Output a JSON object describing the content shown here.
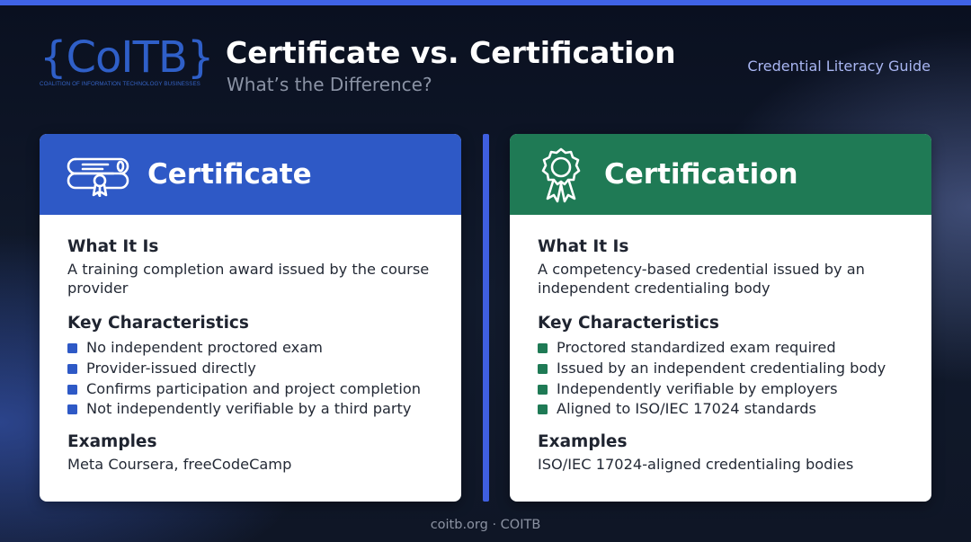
{
  "brand": {
    "logo_text": "{CoITB}",
    "logo_tagline": "COALITION OF INFORMATION TECHNOLOGY BUSINESSES"
  },
  "header": {
    "title": "Certificate vs. Certification",
    "subtitle": "What’s the Difference?",
    "guide_label": "Credential Literacy Guide"
  },
  "cards": [
    {
      "title": "Certificate",
      "icon": "diploma-scroll-icon",
      "accent": "#2e59c6",
      "what_heading": "What It Is",
      "what_text": "A training completion award issued by the course provider",
      "key_heading": "Key Characteristics",
      "characteristics": [
        "No independent proctored exam",
        "Provider-issued directly",
        "Confirms participation and project completion",
        "Not independently verifiable by a third party"
      ],
      "examples_heading": "Examples",
      "examples_text": "Meta Coursera, freeCodeCamp"
    },
    {
      "title": "Certification",
      "icon": "award-ribbon-icon",
      "accent": "#1f7a55",
      "what_heading": "What It Is",
      "what_text": "A competency-based credential issued by an independent credentialing body",
      "key_heading": "Key Characteristics",
      "characteristics": [
        "Proctored standardized exam required",
        "Issued by an independent credentialing body",
        "Independently verifiable by employers",
        "Aligned to ISO/IEC 17024 standards"
      ],
      "examples_heading": "Examples",
      "examples_text": "ISO/IEC 17024-aligned credentialing bodies"
    }
  ],
  "footer": {
    "text": "coitb.org · COITB"
  }
}
